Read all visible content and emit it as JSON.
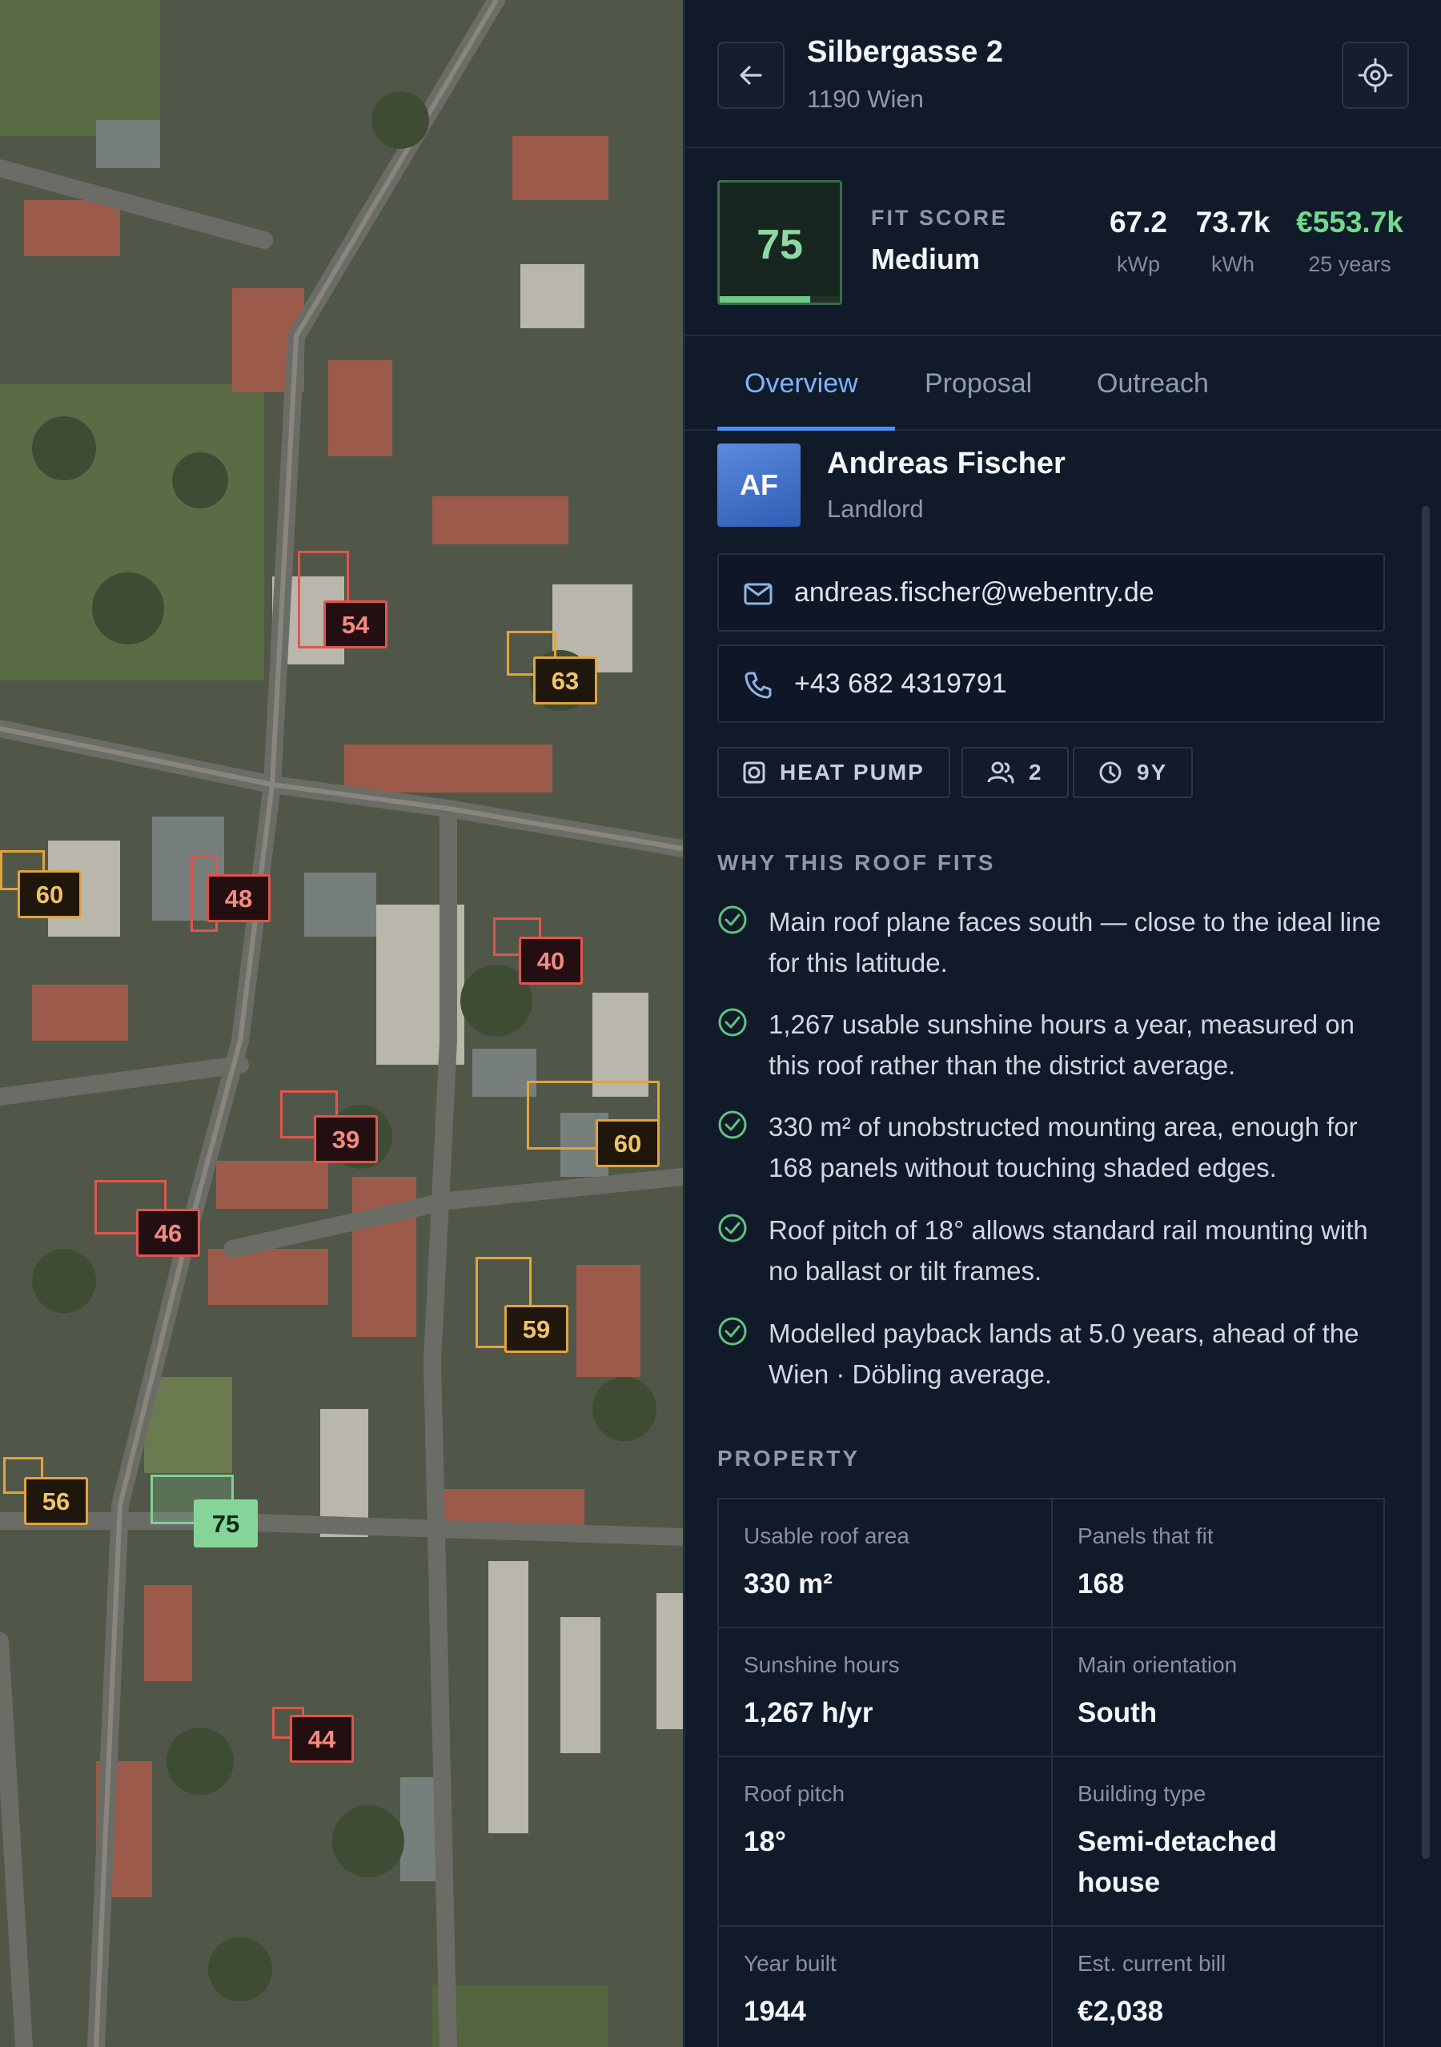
{
  "map": {
    "markers": [
      {
        "id": "m54",
        "score": "54",
        "color": "red"
      },
      {
        "id": "m63",
        "score": "63",
        "color": "orange"
      },
      {
        "id": "m60a",
        "score": "60",
        "color": "orange"
      },
      {
        "id": "m48",
        "score": "48",
        "color": "red"
      },
      {
        "id": "m40",
        "score": "40",
        "color": "red"
      },
      {
        "id": "m39",
        "score": "39",
        "color": "red"
      },
      {
        "id": "m60b",
        "score": "60",
        "color": "orange"
      },
      {
        "id": "m46",
        "score": "46",
        "color": "red"
      },
      {
        "id": "m59",
        "score": "59",
        "color": "orange"
      },
      {
        "id": "m56",
        "score": "56",
        "color": "orange"
      },
      {
        "id": "m75",
        "score": "75",
        "color": "green"
      },
      {
        "id": "m44",
        "score": "44",
        "color": "red"
      }
    ]
  },
  "header": {
    "address": "Silbergasse 2",
    "city": "1190 Wien"
  },
  "score": {
    "value": "75",
    "fill_fraction": 0.75,
    "label": "FIT SCORE",
    "level": "Medium",
    "stats": [
      {
        "value": "67.2",
        "unit": "kWp"
      },
      {
        "value": "73.7k",
        "unit": "kWh"
      },
      {
        "value": "€553.7k",
        "unit": "25 years"
      }
    ]
  },
  "tabs": [
    "Overview",
    "Proposal",
    "Outreach"
  ],
  "contact": {
    "initials": "AF",
    "name": "Andreas Fischer",
    "role": "Landlord",
    "email": "andreas.fischer@webentry.de",
    "phone": "+43 682 4319791"
  },
  "chips": [
    "HEAT PUMP",
    "2",
    "9Y"
  ],
  "why": {
    "title": "WHY THIS ROOF FITS",
    "reasons": [
      "Main roof plane faces south — close to the ideal line for this latitude.",
      "1,267 usable sunshine hours a year, measured on this roof rather than the district average.",
      "330 m² of unobstructed mounting area, enough for 168 panels without touching shaded edges.",
      "Roof pitch of 18° allows standard rail mounting with no ballast or tilt frames.",
      "Modelled payback lands at 5.0 years, ahead of the Wien · Döbling average."
    ]
  },
  "property": {
    "title": "PROPERTY",
    "rows": [
      [
        {
          "label": "Usable roof area",
          "value": "330 m²"
        },
        {
          "label": "Panels that fit",
          "value": "168"
        }
      ],
      [
        {
          "label": "Sunshine hours",
          "value": "1,267 h/yr"
        },
        {
          "label": "Main orientation",
          "value": "South"
        }
      ],
      [
        {
          "label": "Roof pitch",
          "value": "18°"
        },
        {
          "label": "Building type",
          "value": "Semi-detached house"
        }
      ],
      [
        {
          "label": "Year built",
          "value": "1944"
        },
        {
          "label": "Est. current bill",
          "value": "€2,038"
        }
      ]
    ]
  },
  "colors": {
    "accent": "#4b8ef5",
    "score_green": "#8fdaa4",
    "money_green": "#6fdc8c",
    "marker_orange": "#e2a43a",
    "marker_red": "#e0554d"
  }
}
